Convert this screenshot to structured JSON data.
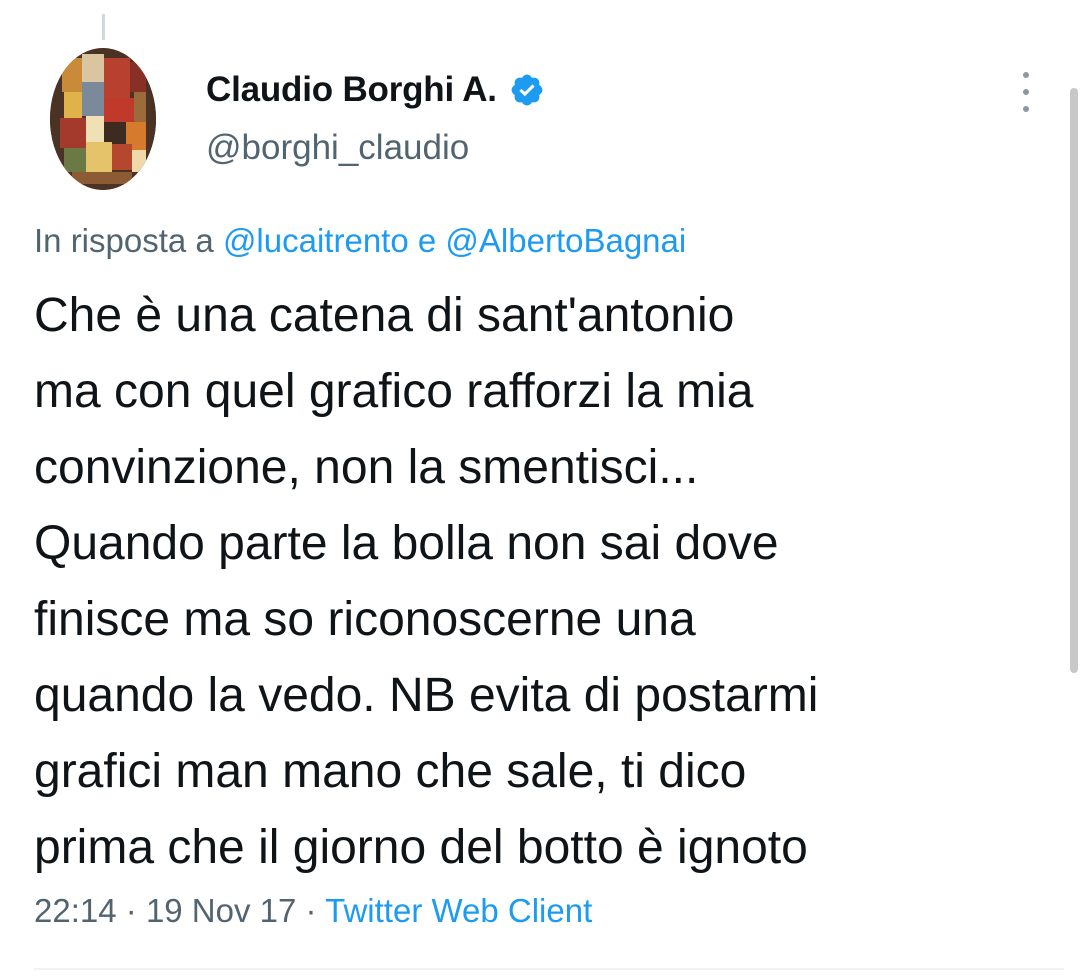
{
  "tweet": {
    "author": {
      "display_name": "Claudio Borghi A.",
      "handle": "@borghi_claudio",
      "verified": true
    },
    "reply_prefix": "In risposta a",
    "reply_mention_1": "@lucaitrento",
    "reply_joiner": "e",
    "reply_mention_2": "@AlbertoBagnai",
    "body_lines": [
      "Che è una catena di sant'antonio",
      "ma con quel grafico rafforzi la mia",
      "convinzione, non la smentisci...",
      "Quando parte la bolla non sai dove",
      "finisce ma so riconoscerne una",
      "quando la vedo. NB evita di postarmi",
      "grafici man mano che sale, ti dico",
      "prima che il giorno del botto è ignoto"
    ],
    "time": "22:14",
    "date": "19 Nov 17",
    "separator": "·",
    "source": "Twitter Web Client"
  },
  "icons": {
    "verified": "verified-badge-icon",
    "more": "more-vertical-icon"
  },
  "colors": {
    "text_primary": "#0f1419",
    "text_secondary": "#536471",
    "link": "#1d9bf0",
    "verified": "#1d9bf0",
    "divider": "#eff3f4"
  }
}
